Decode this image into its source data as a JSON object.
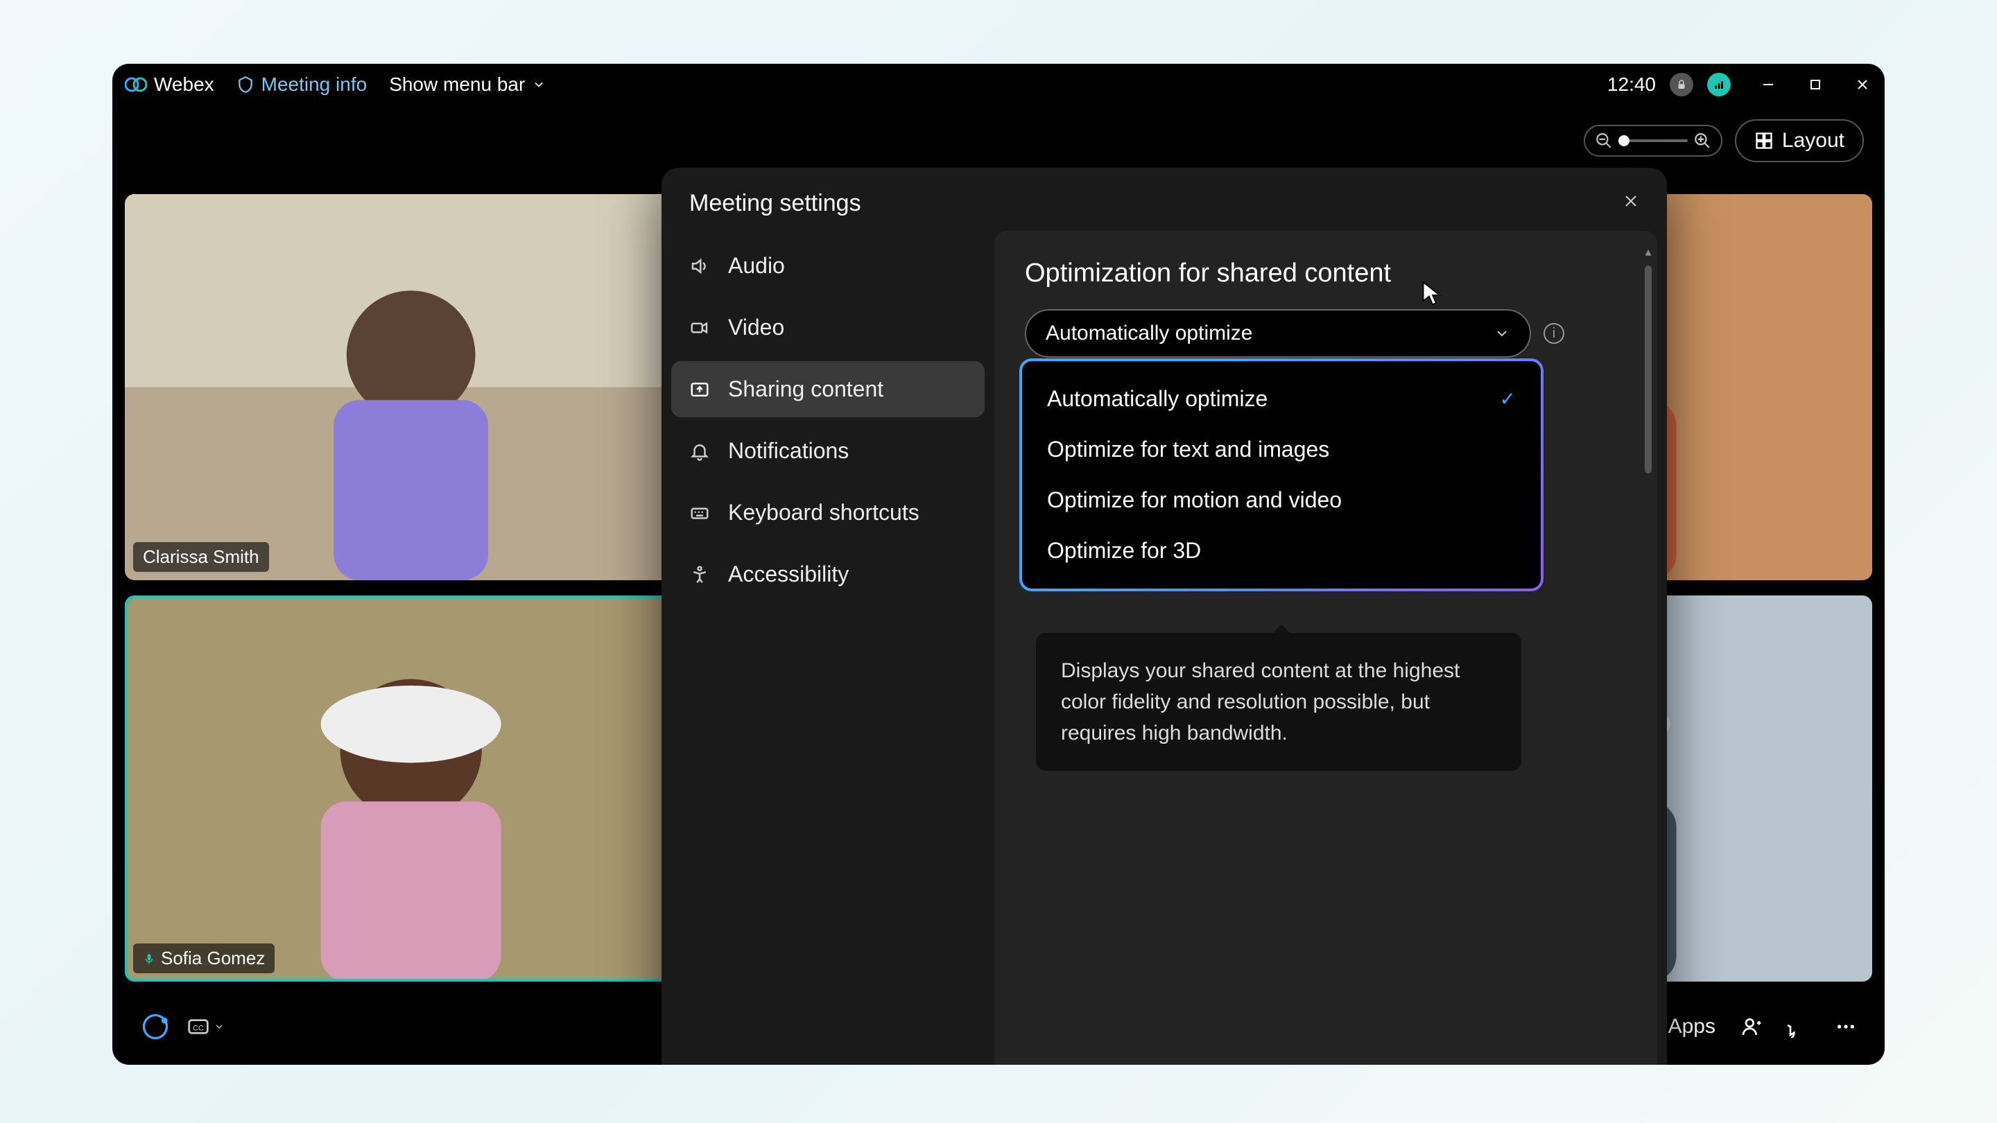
{
  "titlebar": {
    "app_name": "Webex",
    "meeting_info": "Meeting info",
    "show_menu": "Show menu bar",
    "time": "12:40"
  },
  "toolbar": {
    "layout_label": "Layout"
  },
  "participants": [
    {
      "name": "Clarissa Smith"
    },
    {
      "name": "Sofia Gomez"
    }
  ],
  "bottombar": {
    "apps": "Apps"
  },
  "settings": {
    "title": "Meeting settings",
    "sidebar": [
      {
        "key": "audio",
        "label": "Audio"
      },
      {
        "key": "video",
        "label": "Video"
      },
      {
        "key": "sharing",
        "label": "Sharing content"
      },
      {
        "key": "notifications",
        "label": "Notifications"
      },
      {
        "key": "keyboard",
        "label": "Keyboard shortcuts"
      },
      {
        "key": "accessibility",
        "label": "Accessibility"
      }
    ],
    "content": {
      "heading": "Optimization for shared content",
      "selected": "Automatically optimize",
      "options": [
        "Automatically optimize",
        "Optimize for text and images",
        "Optimize for motion and video",
        "Optimize for 3D"
      ],
      "tooltip": "Displays your shared content at the highest color fidelity and resolution possible, but requires high bandwidth."
    }
  }
}
